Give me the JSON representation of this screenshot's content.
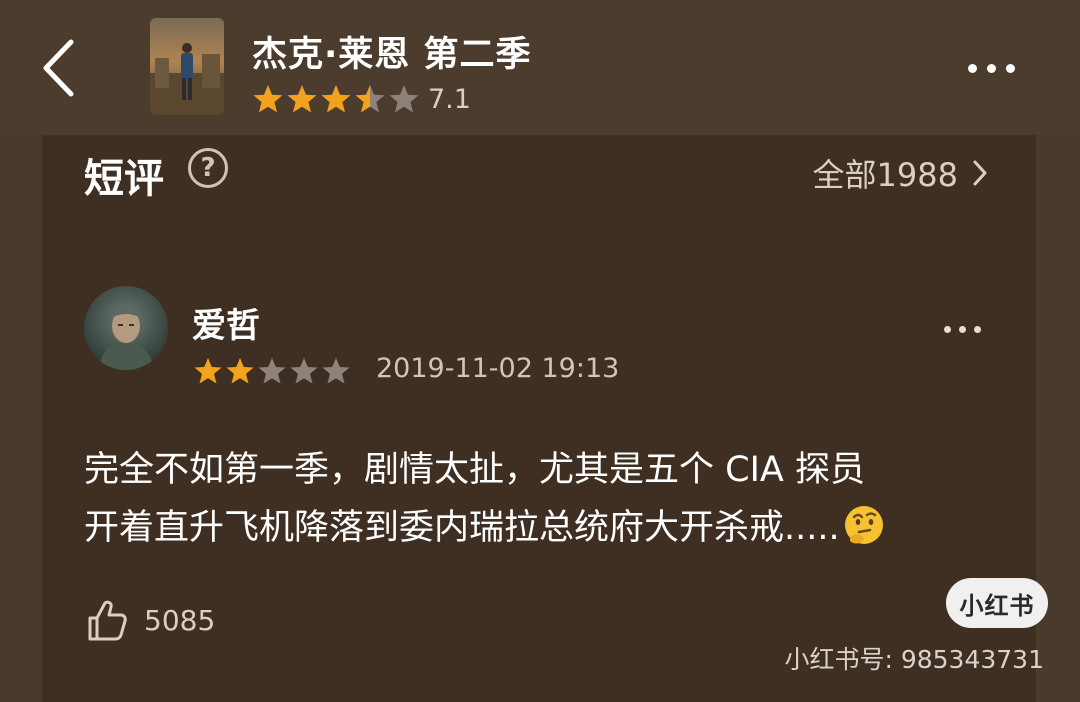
{
  "header": {
    "title": "杰克·莱恩 第二季",
    "rating": "7.1",
    "stars": 3.5,
    "star_color": "#f3a21d",
    "star_empty_color": "#8c8279"
  },
  "section": {
    "title": "短评",
    "help_icon": "?",
    "all_link": "全部1988",
    "chevron": "›"
  },
  "review": {
    "username": "爱哲",
    "stars": 2,
    "timestamp": "2019-11-02 19:13",
    "text_line1": "完全不如第一季，剧情太扯，尤其是五个 CIA 探员",
    "text_line2": "开着直升飞机降落到委内瑞拉总统府大开杀戒.....",
    "emoji": "thinking-face-icon",
    "likes": "5085"
  },
  "watermark": {
    "badge": "小红书",
    "id": "小红书号: 985343731"
  },
  "colors": {
    "background": "#4a3a2c",
    "card": "#3e2f22",
    "text_secondary": "#d9cfc5"
  }
}
